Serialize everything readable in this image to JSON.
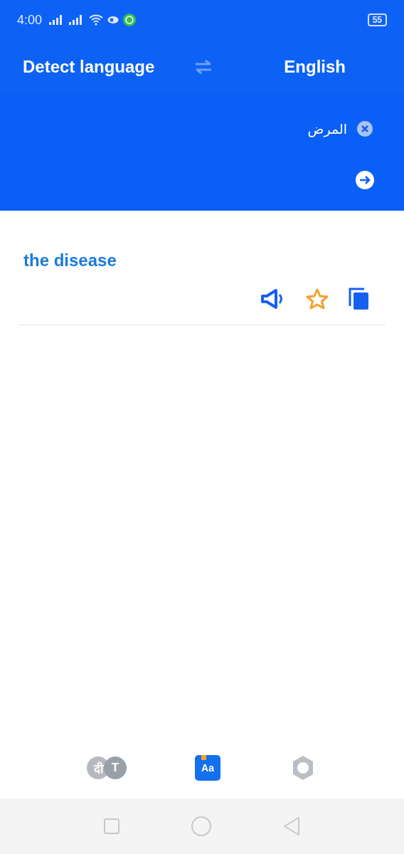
{
  "status_bar": {
    "time": "4:00",
    "battery": "55"
  },
  "language_bar": {
    "source": "Detect language",
    "target": "English"
  },
  "input": {
    "value": "المرض"
  },
  "result": {
    "text": "the disease",
    "favorite": false
  },
  "bottom_nav": [
    {
      "kind": "translate",
      "glyphs": [
        "दी",
        "T"
      ],
      "selected": false
    },
    {
      "kind": "dictionary",
      "glyphs": [
        "Aa"
      ],
      "selected": true
    },
    {
      "kind": "settings",
      "selected": false
    }
  ]
}
